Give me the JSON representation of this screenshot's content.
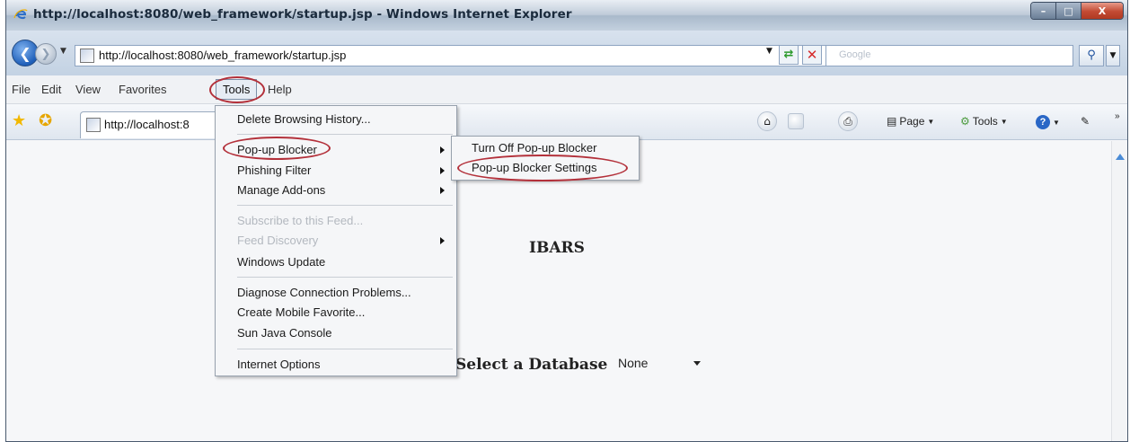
{
  "window": {
    "title": "http://localhost:8080/web_framework/startup.jsp - Windows Internet Explorer",
    "caption_buttons": {
      "minimize": "–",
      "maximize": "□",
      "close": "X"
    }
  },
  "address_bar": {
    "url": "http://localhost:8080/web_framework/startup.jsp",
    "search_placeholder": "Google"
  },
  "menu_bar": {
    "items": [
      "File",
      "Edit",
      "View",
      "Favorites",
      "Tools",
      "Help"
    ]
  },
  "command_bar": {
    "tab_label": "http://localhost:8",
    "page_label": "Page",
    "tools_label": "Tools"
  },
  "tools_menu": {
    "delete_history": "Delete Browsing History...",
    "popup_blocker": "Pop-up Blocker",
    "phishing_filter": "Phishing Filter",
    "manage_addons": "Manage Add-ons",
    "subscribe_feed": "Subscribe to this Feed...",
    "feed_discovery": "Feed Discovery",
    "windows_update": "Windows Update",
    "diagnose": "Diagnose Connection Problems...",
    "mobile_favorite": "Create Mobile Favorite...",
    "java_console": "Sun Java Console",
    "internet_options": "Internet Options"
  },
  "popup_submenu": {
    "turn_off": "Turn Off Pop-up Blocker",
    "settings": "Pop-up Blocker Settings"
  },
  "page": {
    "heading": "IBARS",
    "db_label": "Select a Database",
    "db_selected": "None"
  },
  "colors": {
    "annotation_circle": "#b3303a",
    "title_text": "#1a2a3c"
  },
  "icons": [
    "ie-logo-icon",
    "back-arrow-icon",
    "forward-arrow-icon",
    "refresh-icon",
    "stop-icon",
    "search-icon",
    "favorites-star-icon",
    "add-favorites-icon",
    "home-icon",
    "feeds-icon",
    "print-icon",
    "page-icon",
    "tools-gear-icon",
    "help-icon",
    "research-icon"
  ]
}
